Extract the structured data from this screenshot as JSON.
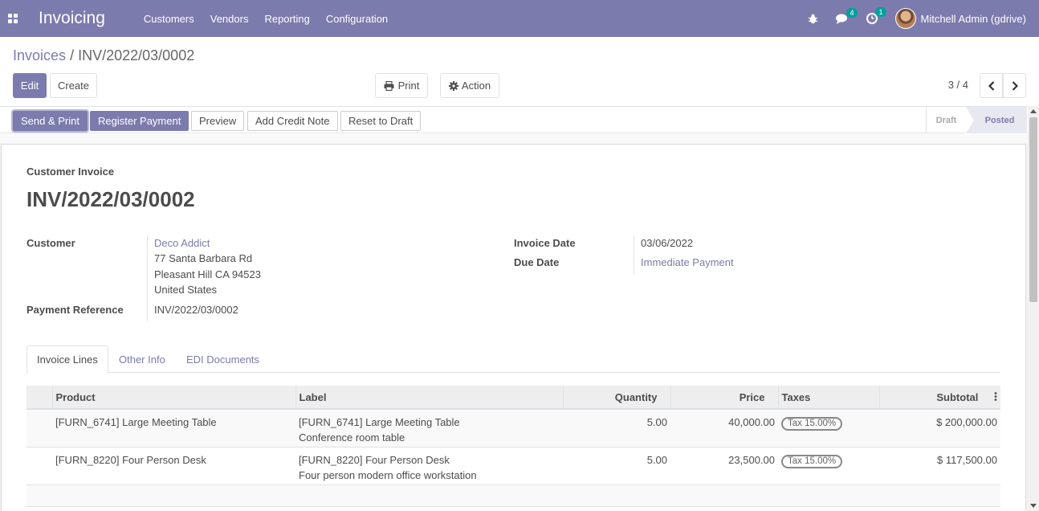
{
  "navbar": {
    "app_name": "Invoicing",
    "menus": [
      "Customers",
      "Vendors",
      "Reporting",
      "Configuration"
    ],
    "messages_count": "4",
    "activities_count": "1",
    "user_name": "Mitchell Admin (gdrive)",
    "accent_color": "#7c7bad"
  },
  "breadcrumb": {
    "parent": "Invoices",
    "separator": "/",
    "current": "INV/2022/03/0002"
  },
  "controls": {
    "edit": "Edit",
    "create": "Create",
    "print": "Print",
    "action": "Action",
    "pager": "3 / 4"
  },
  "statusbar": {
    "buttons": [
      "Send & Print",
      "Register Payment",
      "Preview",
      "Add Credit Note",
      "Reset to Draft"
    ],
    "stages": [
      "Draft",
      "Posted"
    ],
    "current_stage": "Posted"
  },
  "invoice": {
    "type_label": "Customer Invoice",
    "number": "INV/2022/03/0002",
    "customer_label": "Customer",
    "customer_name": "Deco Addict",
    "customer_address": [
      "77 Santa Barbara Rd",
      "Pleasant Hill CA 94523",
      "United States"
    ],
    "payment_ref_label": "Payment Reference",
    "payment_ref": "INV/2022/03/0002",
    "invoice_date_label": "Invoice Date",
    "invoice_date": "03/06/2022",
    "due_date_label": "Due Date",
    "due_date": "Immediate Payment"
  },
  "tabs": [
    "Invoice Lines",
    "Other Info",
    "EDI Documents"
  ],
  "lines": {
    "headers": [
      "Product",
      "Label",
      "Quantity",
      "Price",
      "Taxes",
      "Subtotal"
    ],
    "rows": [
      {
        "product": "[FURN_6741] Large Meeting Table",
        "label1": "[FURN_6741] Large Meeting Table",
        "label2": "Conference room table",
        "quantity": "5.00",
        "price": "40,000.00",
        "tax": "Tax 15.00%",
        "subtotal": "$ 200,000.00"
      },
      {
        "product": "[FURN_8220] Four Person Desk",
        "label1": "[FURN_8220] Four Person Desk",
        "label2": "Four person modern office workstation",
        "quantity": "5.00",
        "price": "23,500.00",
        "tax": "Tax 15.00%",
        "subtotal": "$ 117,500.00"
      }
    ]
  }
}
